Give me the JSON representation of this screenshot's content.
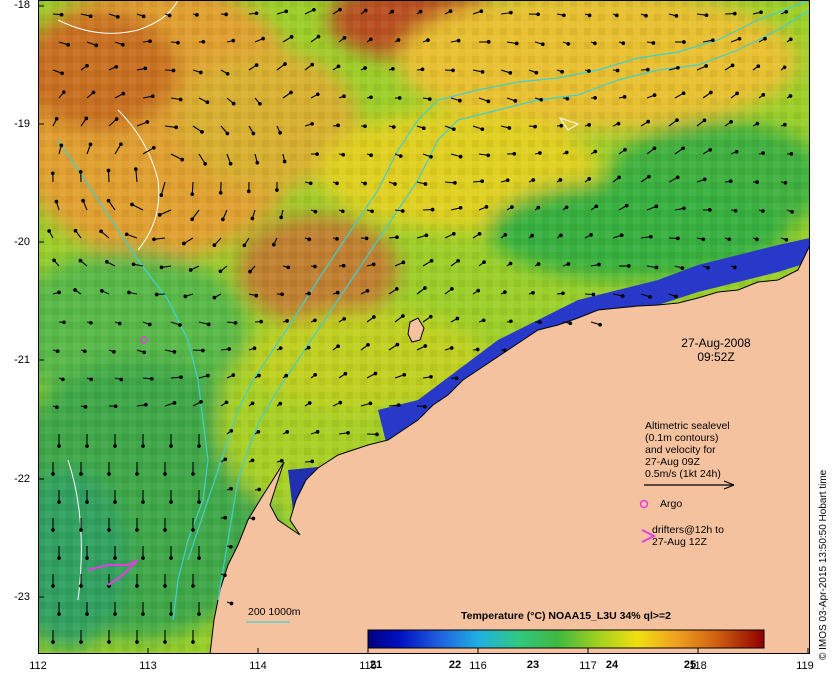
{
  "map": {
    "lon_ticks": [
      "112",
      "113",
      "114",
      "115",
      "116",
      "117",
      "118",
      "119"
    ],
    "lat_ticks": [
      "-18",
      "-19",
      "-20",
      "-21",
      "-22",
      "-23"
    ],
    "lon_range": [
      112,
      119
    ],
    "lat_range": [
      -23.5,
      -18
    ],
    "date": "27-Aug-2008",
    "time": "09:52Z"
  },
  "legend": {
    "altimetric_lines": [
      "Altimetric sealevel",
      "(0.1m contours)",
      "and velocity for",
      "27-Aug 09Z",
      "0.5m/s (1kt 24h)"
    ],
    "argo_label": "Argo",
    "drifters_lines": [
      "drifters@12h to",
      "27-Aug 12Z"
    ],
    "isobath_label": "200  1000m"
  },
  "colorbar": {
    "title": "Temperature (°C) NOAA15_L3U 34% ql>=2",
    "ticks": [
      "21",
      "22",
      "23",
      "24",
      "25"
    ],
    "range": [
      20.8,
      25.8
    ]
  },
  "copyright": "© IMOS 03-Apr-2015 13:50:50 Hobart time",
  "colors": {
    "land": "#f5c29f",
    "coast": "#000000",
    "isobath": "#40d0d0",
    "sealevel_contour": "#ffffff",
    "argo": "#e040e0",
    "drifter": "#e040e0"
  }
}
